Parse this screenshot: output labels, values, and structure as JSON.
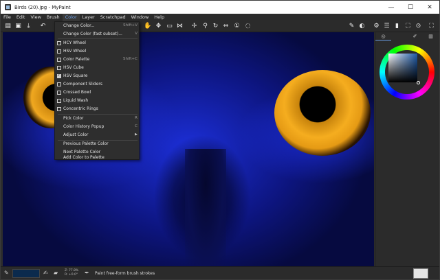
{
  "window": {
    "title": "Birds (20).jpg - MyPaint",
    "minimize": "—",
    "maximize": "☐",
    "close": "✕"
  },
  "menubar": [
    "File",
    "Edit",
    "View",
    "Brush",
    "Color",
    "Layer",
    "Scratchpad",
    "Window",
    "Help"
  ],
  "active_menu": "Color",
  "color_menu": {
    "items": [
      {
        "label": "Change Color...",
        "shortcut": "Shift+V"
      },
      {
        "label": "Change Color (fast subset)...",
        "shortcut": "V"
      },
      {
        "label": "HCY Wheel",
        "checked": false
      },
      {
        "label": "HSV Wheel",
        "checked": false
      },
      {
        "label": "Color Palette",
        "checked": false,
        "shortcut": "Shift+C"
      },
      {
        "label": "HSV Cube",
        "checked": false
      },
      {
        "label": "HSV Square",
        "checked": true
      },
      {
        "label": "Component Sliders",
        "checked": false
      },
      {
        "label": "Crossed Bowl",
        "checked": false
      },
      {
        "label": "Liquid Wash",
        "checked": false
      },
      {
        "label": "Concentric Rings",
        "checked": false
      },
      {
        "label": "Pick Color",
        "shortcut": "R"
      },
      {
        "label": "Color History Popup",
        "shortcut": "C"
      },
      {
        "label": "Adjust Color",
        "submenu": "▶"
      },
      {
        "label": "Previous Palette Color"
      },
      {
        "label": "Next Palette Color"
      },
      {
        "label": "Add Color to Palette"
      }
    ]
  },
  "toolbar": {
    "icons": [
      "new-file-icon",
      "open-file-icon",
      "save-icon",
      "undo-icon",
      "freehand-icon",
      "move-icon",
      "zoom-icon",
      "rotate-icon",
      "mirror-icon",
      "reset-view-icon",
      "fit-view-icon",
      "brush-settings-icon",
      "settings-icon",
      "layers-menu-icon",
      "scratchpad-icon",
      "fullscreen-icon",
      "help-icon"
    ]
  },
  "statusbar": {
    "zoom_line1": "Z: 77.8%",
    "zoom_line2": "R: +0.0°",
    "message": "Paint free-form brush strokes",
    "swatch_color": "#0b2a4d"
  },
  "panel": {
    "tabs": [
      "color-tab",
      "",
      "brush-tab",
      "layers-tab"
    ],
    "selected_color": "#1e5aa8"
  }
}
